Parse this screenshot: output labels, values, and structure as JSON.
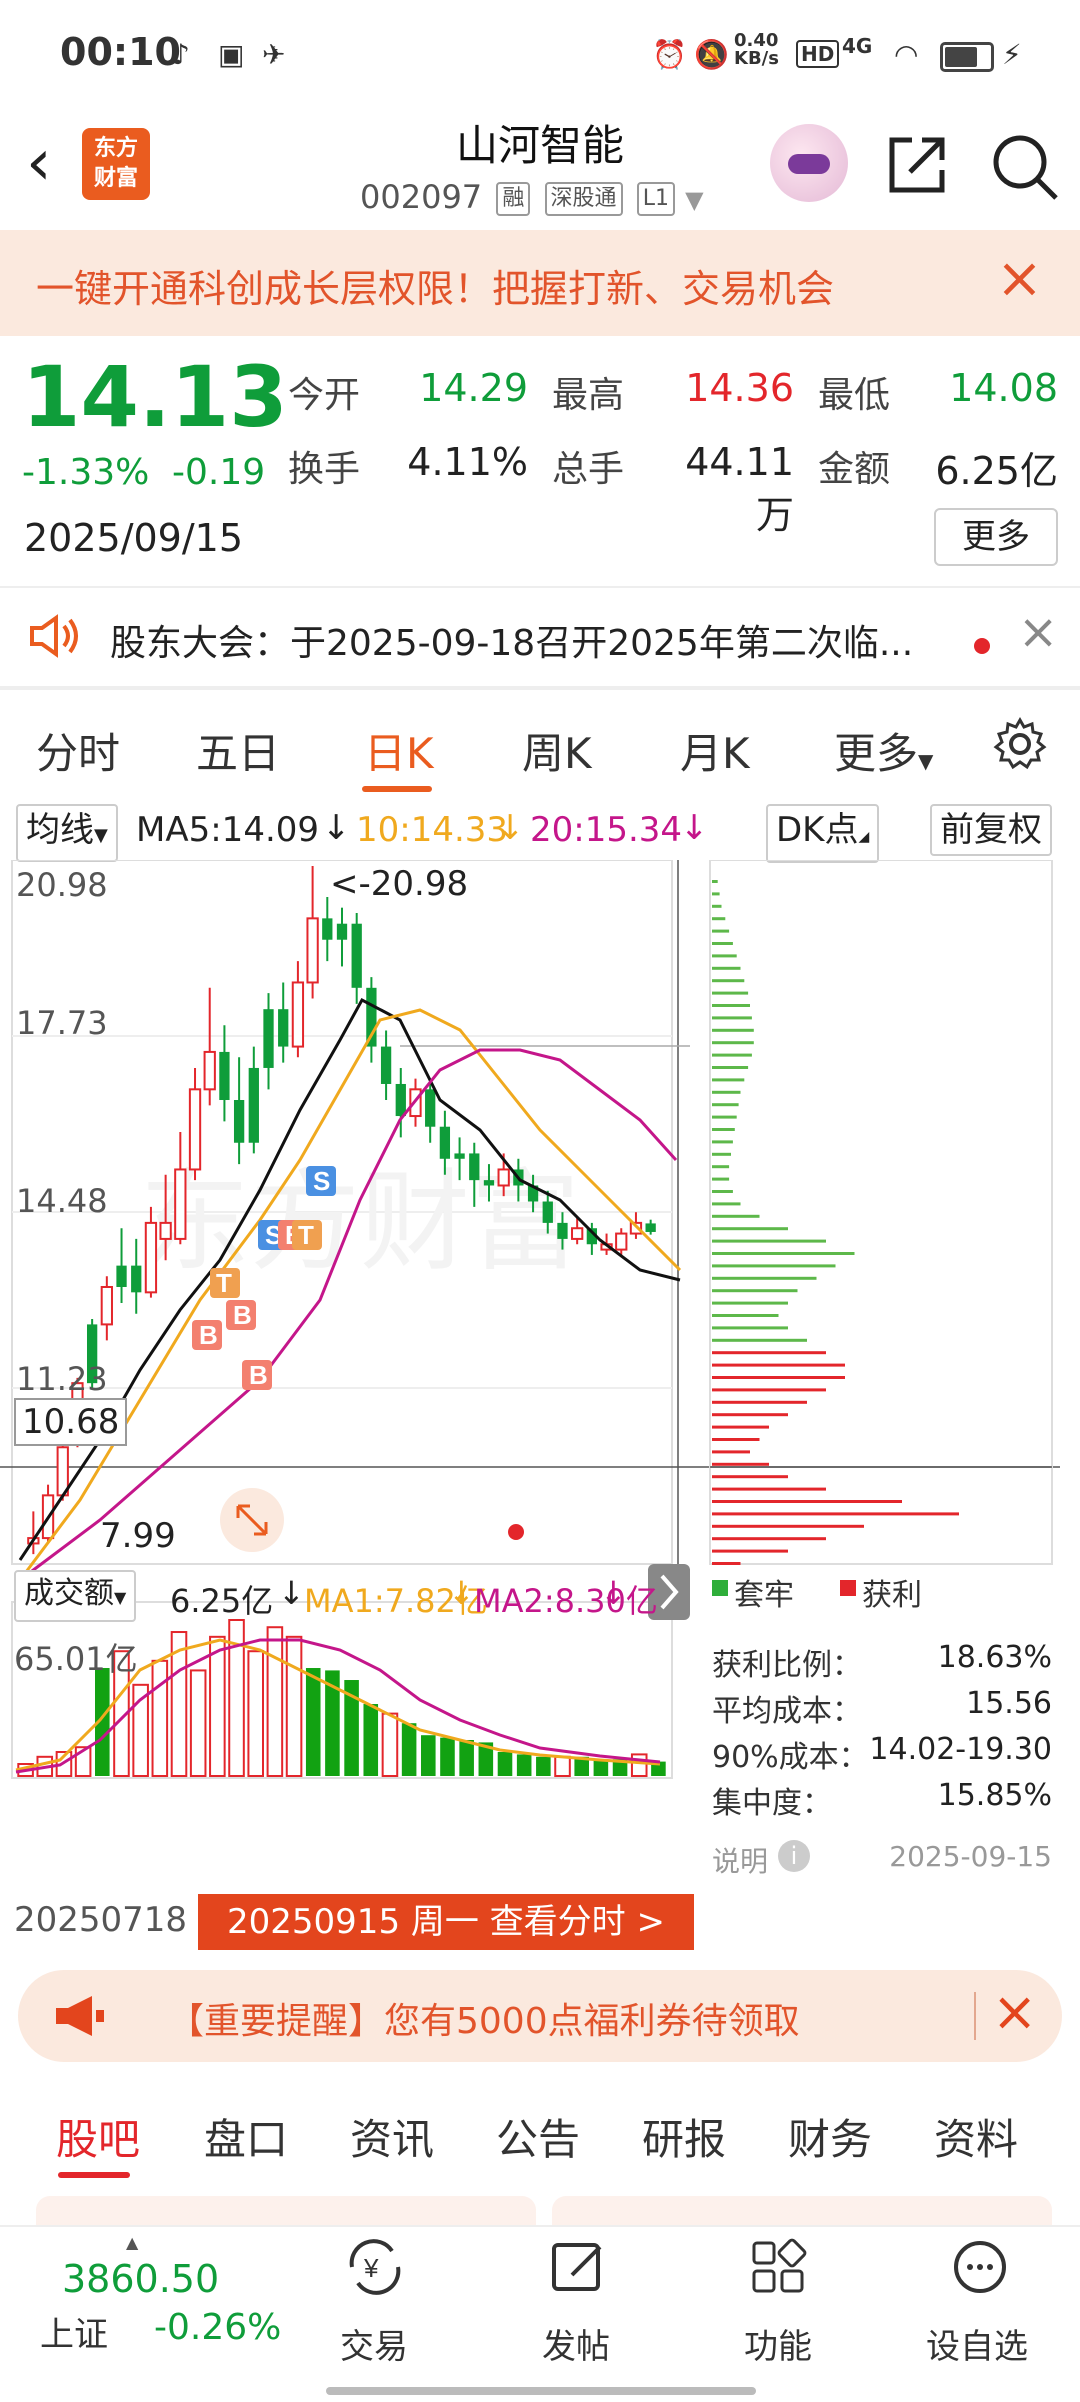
{
  "status_bar": {
    "time": "00:10",
    "net_speed": "0.40\nKB/s",
    "hd": "HD",
    "signal": "4G"
  },
  "header": {
    "back_icon": "chevron-left-icon",
    "logo_text_1": "东方",
    "logo_text_2": "财富",
    "stock_name": "山河智能",
    "stock_code": "002097",
    "tag_rong": "融",
    "tag_shengutong": "深股通",
    "tag_level": "L1"
  },
  "banner": {
    "text": "一键开通科创成长层权限！把握打新、交易机会"
  },
  "quote": {
    "price": "14.13",
    "change_pct": "-1.33%",
    "change_abs": "-0.19",
    "date": "2025/09/15",
    "open_label": "今开",
    "open_value": "14.29",
    "high_label": "最高",
    "high_value": "14.36",
    "low_label": "最低",
    "low_value": "14.08",
    "turnover_label": "换手",
    "turnover_value": "4.11%",
    "volume_label": "总手",
    "volume_value": "44.11万",
    "amount_label": "金额",
    "amount_value": "6.25亿",
    "more_label": "更多",
    "colors": {
      "down": "#0f9d3a",
      "up": "#e3262b"
    }
  },
  "notice": {
    "text": "股东大会：于2025-09-18召开2025年第二次临..."
  },
  "tabs": [
    {
      "label": "分时"
    },
    {
      "label": "五日"
    },
    {
      "label": "日K"
    },
    {
      "label": "周K"
    },
    {
      "label": "月K"
    },
    {
      "label": "更多"
    }
  ],
  "kline": {
    "ma_select": "均线",
    "ma5_text": "MA5:14.09",
    "ma10_text": "10:14.33",
    "ma20_text": "20:15.34",
    "dk_label": "DK点",
    "adjust_label": "前复权",
    "y_labels": [
      "20.98",
      "17.73",
      "14.48",
      "11.23"
    ],
    "max_annotation": "<-20.98",
    "min_annotation": "7.99",
    "cursor_price": "10.68"
  },
  "volume": {
    "select": "成交额",
    "value_text": "6.25亿",
    "ma1_text": "MA1:7.82亿",
    "ma2_text": "MA2:8.30亿",
    "max_label": "65.01亿",
    "start_date": "20250718",
    "tooltip": "20250915 周一 查看分时 >"
  },
  "chip": {
    "legend_trapped": "套牢",
    "legend_profit": "获利",
    "rows": [
      {
        "label": "获利比例：",
        "value": "18.63%"
      },
      {
        "label": "平均成本：",
        "value": "15.56"
      },
      {
        "label": "90%成本：",
        "value": "14.02-19.30"
      },
      {
        "label": "集中度：",
        "value": "15.85%"
      }
    ],
    "note_label": "说明",
    "note_date": "2025-09-15"
  },
  "promo": {
    "text": "【重要提醒】您有5000点福利券待领取"
  },
  "bottom_tabs": [
    {
      "label": "股吧"
    },
    {
      "label": "盘口"
    },
    {
      "label": "资讯"
    },
    {
      "label": "公告"
    },
    {
      "label": "研报"
    },
    {
      "label": "财务"
    },
    {
      "label": "资料"
    }
  ],
  "bottom_bar": {
    "index_value": "3860.50",
    "index_name": "上证",
    "index_change": "-0.26%",
    "trade_label": "交易",
    "post_label": "发帖",
    "func_label": "功能",
    "watch_label": "设自选"
  },
  "chart_data": {
    "type": "candlestick",
    "y_range": [
      7.99,
      20.98
    ],
    "candles": [
      {
        "o": 8.3,
        "c": 8.4,
        "h": 8.9,
        "l": 8.1,
        "up": true
      },
      {
        "o": 8.4,
        "c": 9.2,
        "h": 9.4,
        "l": 8.3,
        "up": true
      },
      {
        "o": 9.2,
        "c": 10.1,
        "h": 10.2,
        "l": 9.1,
        "up": true
      },
      {
        "o": 10.2,
        "c": 11.3,
        "h": 11.4,
        "l": 10.1,
        "up": true
      },
      {
        "o": 11.3,
        "c": 12.4,
        "h": 12.5,
        "l": 11.2,
        "up": false
      },
      {
        "o": 12.4,
        "c": 13.1,
        "h": 13.3,
        "l": 12.1,
        "up": true
      },
      {
        "o": 13.1,
        "c": 13.5,
        "h": 14.2,
        "l": 12.8,
        "up": false
      },
      {
        "o": 13.5,
        "c": 13.0,
        "h": 14.0,
        "l": 12.6,
        "up": false
      },
      {
        "o": 13.0,
        "c": 14.3,
        "h": 14.6,
        "l": 12.9,
        "up": true
      },
      {
        "o": 14.3,
        "c": 14.0,
        "h": 15.2,
        "l": 13.6,
        "up": true
      },
      {
        "o": 14.0,
        "c": 15.3,
        "h": 16.0,
        "l": 13.9,
        "up": true
      },
      {
        "o": 15.3,
        "c": 16.8,
        "h": 17.2,
        "l": 15.1,
        "up": true
      },
      {
        "o": 16.8,
        "c": 17.5,
        "h": 18.7,
        "l": 16.5,
        "up": true
      },
      {
        "o": 17.5,
        "c": 16.6,
        "h": 18.0,
        "l": 16.2,
        "up": false
      },
      {
        "o": 16.6,
        "c": 15.8,
        "h": 17.4,
        "l": 15.4,
        "up": false
      },
      {
        "o": 15.8,
        "c": 17.2,
        "h": 17.6,
        "l": 15.6,
        "up": false
      },
      {
        "o": 17.2,
        "c": 18.3,
        "h": 18.6,
        "l": 16.8,
        "up": false
      },
      {
        "o": 18.3,
        "c": 17.6,
        "h": 18.8,
        "l": 17.3,
        "up": false
      },
      {
        "o": 17.6,
        "c": 18.8,
        "h": 19.2,
        "l": 17.4,
        "up": true
      },
      {
        "o": 18.8,
        "c": 20.0,
        "h": 20.98,
        "l": 18.5,
        "up": true
      },
      {
        "o": 20.0,
        "c": 19.6,
        "h": 20.4,
        "l": 19.2,
        "up": false
      },
      {
        "o": 19.6,
        "c": 19.9,
        "h": 20.2,
        "l": 19.1,
        "up": false
      },
      {
        "o": 19.9,
        "c": 18.7,
        "h": 20.1,
        "l": 18.4,
        "up": false
      },
      {
        "o": 18.7,
        "c": 17.6,
        "h": 18.9,
        "l": 17.3,
        "up": false
      },
      {
        "o": 17.6,
        "c": 16.9,
        "h": 17.9,
        "l": 16.6,
        "up": false
      },
      {
        "o": 16.9,
        "c": 16.3,
        "h": 17.2,
        "l": 15.9,
        "up": false
      },
      {
        "o": 16.3,
        "c": 16.8,
        "h": 17.0,
        "l": 16.1,
        "up": true
      },
      {
        "o": 16.8,
        "c": 16.1,
        "h": 17.0,
        "l": 15.8,
        "up": false
      },
      {
        "o": 16.1,
        "c": 15.5,
        "h": 16.4,
        "l": 15.2,
        "up": false
      },
      {
        "o": 15.5,
        "c": 15.6,
        "h": 15.9,
        "l": 15.1,
        "up": false
      },
      {
        "o": 15.6,
        "c": 15.1,
        "h": 15.8,
        "l": 14.6,
        "up": false
      },
      {
        "o": 15.1,
        "c": 15.0,
        "h": 15.4,
        "l": 14.7,
        "up": false
      },
      {
        "o": 15.0,
        "c": 15.3,
        "h": 15.6,
        "l": 14.8,
        "up": true
      },
      {
        "o": 15.3,
        "c": 15.0,
        "h": 15.5,
        "l": 14.7,
        "up": false
      },
      {
        "o": 15.0,
        "c": 14.7,
        "h": 15.2,
        "l": 14.5,
        "up": false
      },
      {
        "o": 14.7,
        "c": 14.3,
        "h": 14.9,
        "l": 14.1,
        "up": false
      },
      {
        "o": 14.3,
        "c": 14.0,
        "h": 14.5,
        "l": 13.8,
        "up": false
      },
      {
        "o": 14.0,
        "c": 14.2,
        "h": 14.4,
        "l": 13.9,
        "up": true
      },
      {
        "o": 14.2,
        "c": 13.9,
        "h": 14.3,
        "l": 13.7,
        "up": false
      },
      {
        "o": 13.9,
        "c": 13.8,
        "h": 14.1,
        "l": 13.7,
        "up": true
      },
      {
        "o": 13.8,
        "c": 14.1,
        "h": 14.2,
        "l": 13.7,
        "up": true
      },
      {
        "o": 14.1,
        "c": 14.3,
        "h": 14.5,
        "l": 14.0,
        "up": true
      },
      {
        "o": 14.29,
        "c": 14.13,
        "h": 14.36,
        "l": 14.08,
        "up": false
      }
    ],
    "volume_bars": [
      {
        "v": 5.0,
        "up": true
      },
      {
        "v": 8.0,
        "up": true
      },
      {
        "v": 10.0,
        "up": true
      },
      {
        "v": 12.0,
        "up": true
      },
      {
        "v": 45.0,
        "up": false
      },
      {
        "v": 52.0,
        "up": true
      },
      {
        "v": 38.0,
        "up": true
      },
      {
        "v": 48.0,
        "up": true
      },
      {
        "v": 60.0,
        "up": true
      },
      {
        "v": 44.0,
        "up": true
      },
      {
        "v": 58.0,
        "up": true
      },
      {
        "v": 65.01,
        "up": true
      },
      {
        "v": 52.0,
        "up": true
      },
      {
        "v": 62.0,
        "up": true
      },
      {
        "v": 58.0,
        "up": true
      },
      {
        "v": 45.0,
        "up": false
      },
      {
        "v": 44.0,
        "up": false
      },
      {
        "v": 40.0,
        "up": false
      },
      {
        "v": 30.0,
        "up": false
      },
      {
        "v": 26.0,
        "up": true
      },
      {
        "v": 22.0,
        "up": false
      },
      {
        "v": 17.0,
        "up": false
      },
      {
        "v": 16.0,
        "up": false
      },
      {
        "v": 15.0,
        "up": false
      },
      {
        "v": 14.0,
        "up": false
      },
      {
        "v": 10.0,
        "up": false
      },
      {
        "v": 9.0,
        "up": false
      },
      {
        "v": 8.0,
        "up": false
      },
      {
        "v": 8.0,
        "up": true
      },
      {
        "v": 8.0,
        "up": false
      },
      {
        "v": 7.0,
        "up": false
      },
      {
        "v": 7.0,
        "up": false
      },
      {
        "v": 9.0,
        "up": true
      },
      {
        "v": 6.0,
        "up": false
      }
    ]
  }
}
